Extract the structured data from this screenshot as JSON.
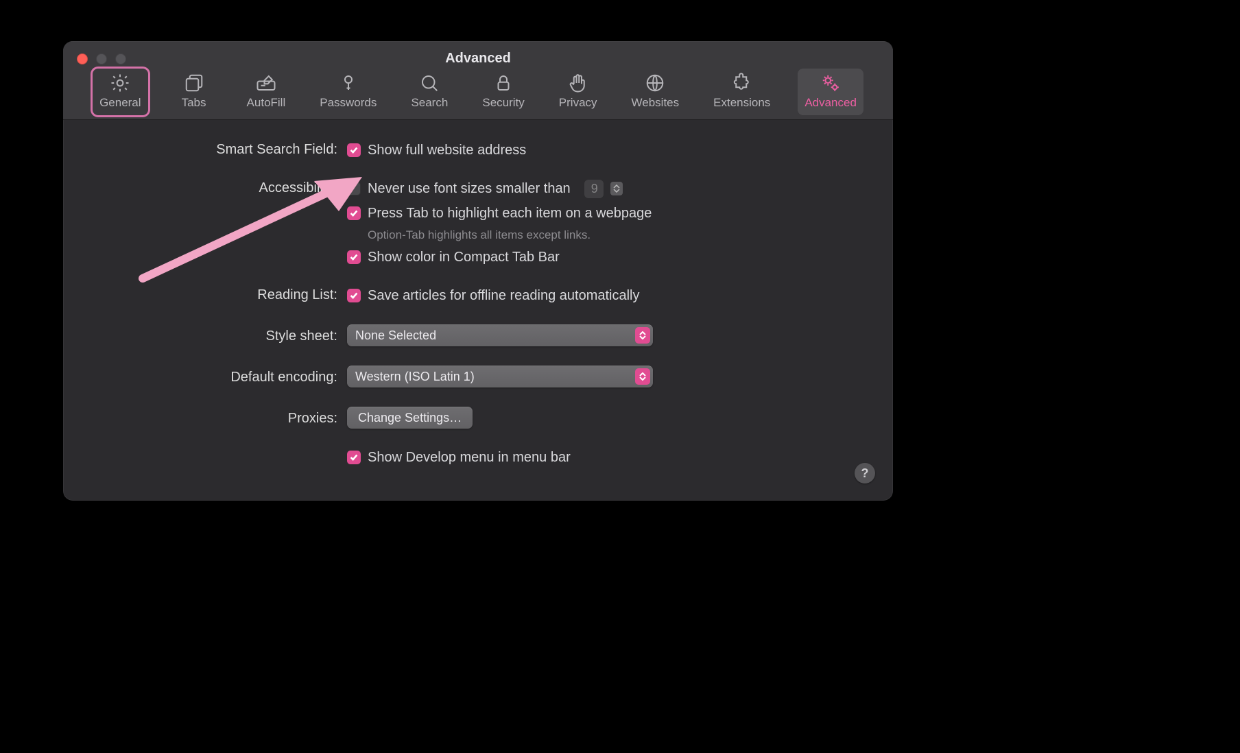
{
  "window": {
    "title": "Advanced"
  },
  "tabs": {
    "general": "General",
    "tabs": "Tabs",
    "autofill": "AutoFill",
    "passwords": "Passwords",
    "search": "Search",
    "security": "Security",
    "privacy": "Privacy",
    "websites": "Websites",
    "extensions": "Extensions",
    "advanced": "Advanced"
  },
  "sections": {
    "smartSearch": {
      "label": "Smart Search Field:",
      "showFullAddress": "Show full website address"
    },
    "accessibility": {
      "label": "Accessibility:",
      "neverUseFont": "Never use font sizes smaller than",
      "fontSizeValue": "9",
      "pressTab": "Press Tab to highlight each item on a webpage",
      "pressTabHint": "Option-Tab highlights all items except links.",
      "showColor": "Show color in Compact Tab Bar"
    },
    "readingList": {
      "label": "Reading List:",
      "saveOffline": "Save articles for offline reading automatically"
    },
    "stylesheet": {
      "label": "Style sheet:",
      "value": "None Selected"
    },
    "encoding": {
      "label": "Default encoding:",
      "value": "Western (ISO Latin 1)"
    },
    "proxies": {
      "label": "Proxies:",
      "button": "Change Settings…"
    },
    "develop": {
      "showDevelop": "Show Develop menu in menu bar"
    }
  },
  "help": "?"
}
